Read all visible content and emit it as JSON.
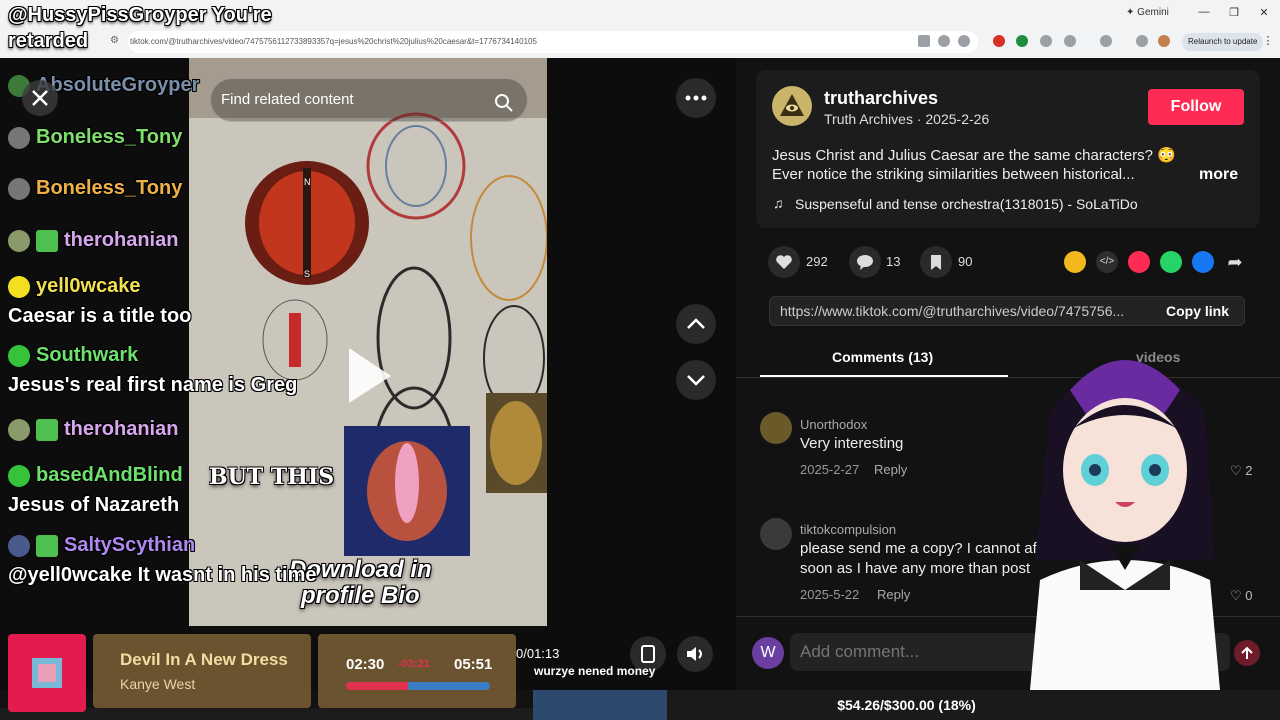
{
  "browser": {
    "url": "tiktok.com/@trutharchives/video/7475756112733893357q=jesus%20christ%20julius%20caesar&t=1776734140105",
    "gemini_label": "Gemini",
    "relaunch_label": "Relaunch to update"
  },
  "stream": {
    "title_line1": "@HussyPissGroyper You're",
    "title_line2": "retarded",
    "chat": [
      {
        "user": "AbsoluteGroyper",
        "color": "#7a8fa8",
        "message": ""
      },
      {
        "user": "Boneless_Tony",
        "color": "#7ee06a",
        "message": ""
      },
      {
        "user": "Boneless_Tony",
        "color": "#f0b048",
        "message": ""
      },
      {
        "user": "therohanian",
        "color": "#d7a7ee",
        "message": ""
      },
      {
        "user": "yell0wcake",
        "color": "#f2e050",
        "message": "Caesar is a title too"
      },
      {
        "user": "Southwark",
        "color": "#6ee06e",
        "message": "Jesus's real first name is Greg"
      },
      {
        "user": "therohanian",
        "color": "#d7a7ee",
        "message": ""
      },
      {
        "user": "basedAndBlind",
        "color": "#6ee06e",
        "message": "Jesus of Nazareth"
      },
      {
        "user": "SaltyScythian",
        "color": "#b089f0",
        "message": "@yell0wcake It wasnt in his time"
      }
    ]
  },
  "video": {
    "search_placeholder": "Find related content",
    "caption_main": "BUT THIS",
    "caption_line1": "Download in",
    "caption_line2": "profile Bio",
    "time": "0/01:13",
    "labels": [
      "N",
      "S"
    ]
  },
  "post": {
    "username": "trutharchives",
    "display": "Truth Archives · 2025-2-26",
    "follow_label": "Follow",
    "desc_line1": "Jesus Christ and Julius Caesar are the same characters? 😳",
    "desc_line2": "Ever notice the striking similarities between historical...",
    "more_label": "more",
    "music": "Suspenseful and tense orchestra(1318015) - SoLaTiDo",
    "likes": "292",
    "comments": "13",
    "saves": "90",
    "link": "https://www.tiktok.com/@trutharchives/video/7475756...",
    "copy_label": "Copy link"
  },
  "tabs": {
    "comments_label": "Comments (13)",
    "videos_label": "videos"
  },
  "comments": [
    {
      "user": "Unorthodox",
      "text": "Very interesting",
      "text2": "",
      "date": "2025-2-27",
      "reply": "Reply",
      "likes": "2"
    },
    {
      "user": "tiktokcompulsion",
      "text": "please send me a copy? I cannot af",
      "text2": "soon as I have any more than post",
      "date": "2025-5-22",
      "reply": "Reply",
      "likes": "0"
    }
  ],
  "comment_input": {
    "avatar_letter": "W",
    "placeholder": "Add comment..."
  },
  "now_playing": {
    "title": "Devil In A New Dress",
    "artist": "Kanye West",
    "current": "02:30",
    "remaining": "-03:21",
    "total": "05:51",
    "progress_fraction": 0.43
  },
  "donation": {
    "name": "wurzye nened money",
    "goal_text": "$54.26/$300.00 (18%)",
    "goal_fraction": 0.18
  },
  "colors": {
    "accent": "#fe2c55",
    "panel_bg": "#121212"
  }
}
